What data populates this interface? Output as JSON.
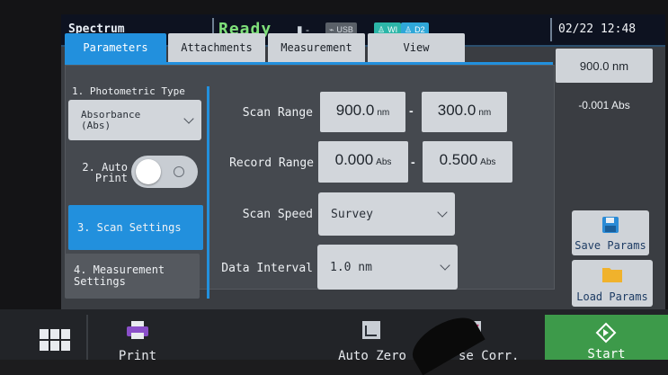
{
  "status_bar": {
    "app_title": "Spectrum",
    "state": "Ready",
    "battery": "▮ -",
    "usb": "USB",
    "wi": "WI",
    "d2": "D2",
    "datetime": "02/22 12:48"
  },
  "tabs": [
    {
      "label": "Parameters",
      "active": true
    },
    {
      "label": "Attachments",
      "active": false
    },
    {
      "label": "Measurement",
      "active": false
    },
    {
      "label": "View",
      "active": false
    }
  ],
  "left_menu": {
    "photometric_label": "1. Photometric Type",
    "photometric_value": "Absorbance (Abs)",
    "auto_print_label": "2. Auto Print",
    "auto_print_on": false,
    "scan_settings": "3. Scan Settings",
    "measurement_settings": "4. Measurement Settings"
  },
  "scan_settings": {
    "scan_range_label": "Scan Range",
    "scan_start": "900.0",
    "scan_start_unit": "nm",
    "scan_end": "300.0",
    "scan_end_unit": "nm",
    "record_range_label": "Record Range",
    "record_low": "0.000",
    "record_low_unit": "Abs",
    "record_high": "0.500",
    "record_high_unit": "Abs",
    "scan_speed_label": "Scan Speed",
    "scan_speed_value": "Survey",
    "data_interval_label": "Data Interval",
    "data_interval_value": "1.0 nm"
  },
  "right_panel": {
    "wavelength": "900.0 nm",
    "absorbance": "-0.001 Abs",
    "save_params": "Save Params",
    "load_params": "Load Params"
  },
  "bottom_bar": {
    "print": "Print",
    "auto_zero": "Auto Zero",
    "base_corr": "se Corr.",
    "start": "Start"
  },
  "colors": {
    "accent": "#2290dd",
    "ready": "#7fe07a",
    "start": "#3d9a4a"
  }
}
